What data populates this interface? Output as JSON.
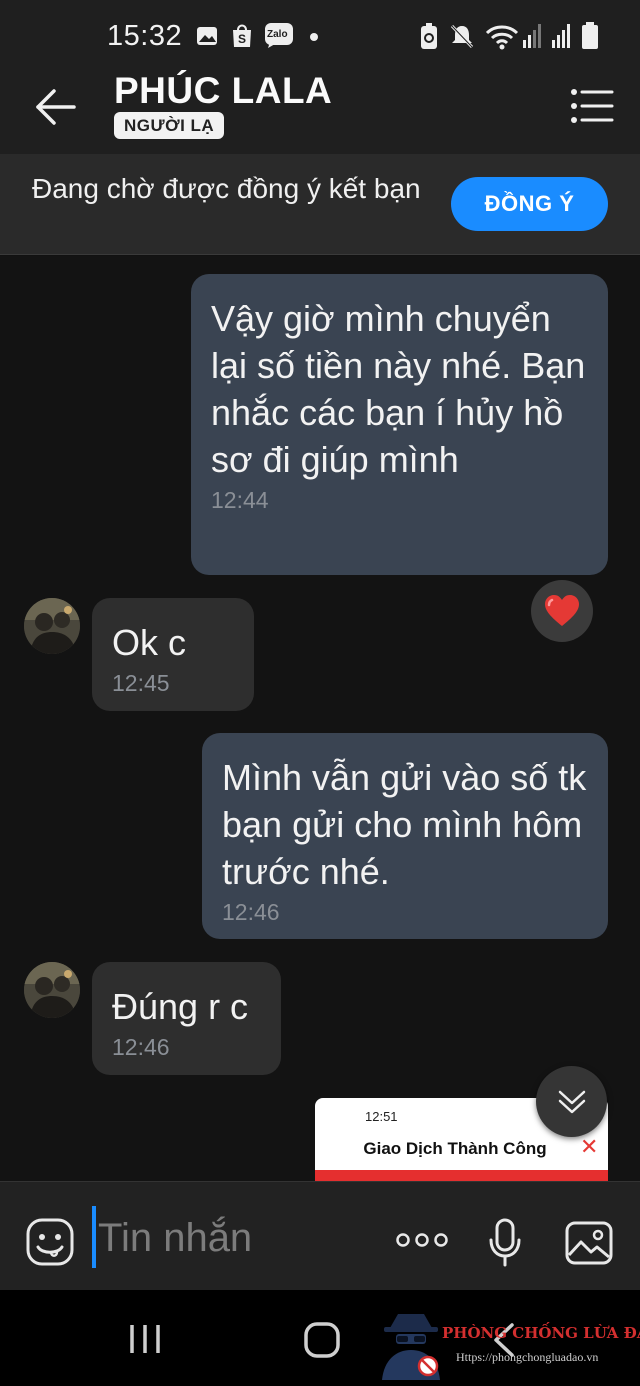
{
  "status_bar": {
    "time": "15:32",
    "left_icons": [
      "gallery-icon",
      "shopee-icon",
      "zalo-icon",
      "dot-icon"
    ],
    "right_icons": [
      "battery-saver-icon",
      "mute-icon",
      "wifi-icon",
      "signal-icon",
      "signal-icon",
      "battery-icon"
    ],
    "zalo_label": "Zalo"
  },
  "header": {
    "contact_name": "PHÚC LALA",
    "badge": "NGƯỜI LẠ",
    "back_icon": "arrow-left-icon",
    "menu_icon": "menu-list-icon"
  },
  "banner": {
    "text": "Đang chờ được đồng ý kết bạn",
    "accept_label": "ĐỒNG Ý",
    "accent": "#1a8cff"
  },
  "messages": [
    {
      "direction": "out",
      "text": "Vậy giờ mình chuyển lại số tiền này nhé. Bạn nhắc các bạn í hủy hồ sơ đi giúp mình",
      "time": "12:44",
      "reaction": "heart"
    },
    {
      "direction": "in",
      "text": "Ok c",
      "time": "12:45"
    },
    {
      "direction": "out",
      "text": "Mình vẫn gửi vào số tk bạn gửi cho mình hôm trước nhé.",
      "time": "12:46"
    },
    {
      "direction": "in",
      "text": "Đúng r c",
      "time": "12:46"
    }
  ],
  "image_preview": {
    "time": "12:51",
    "title": "Giao Dịch Thành Công"
  },
  "composer": {
    "placeholder": "Tin nhắn",
    "icons": [
      "emoji-icon",
      "more-icon",
      "microphone-icon",
      "image-icon"
    ]
  },
  "nav_bar": {
    "icons": [
      "recent-apps-icon",
      "home-icon",
      "back-icon"
    ]
  },
  "watermark": {
    "title": "PHÒNG CHỐNG LỪA ĐẢO",
    "url": "Https://phongchongluadao.vn"
  },
  "colors": {
    "outgoing_bubble": "#3a4452",
    "incoming_bubble": "#2e2e2e",
    "heart": "#e53935",
    "watermark": "#d32f2f"
  }
}
